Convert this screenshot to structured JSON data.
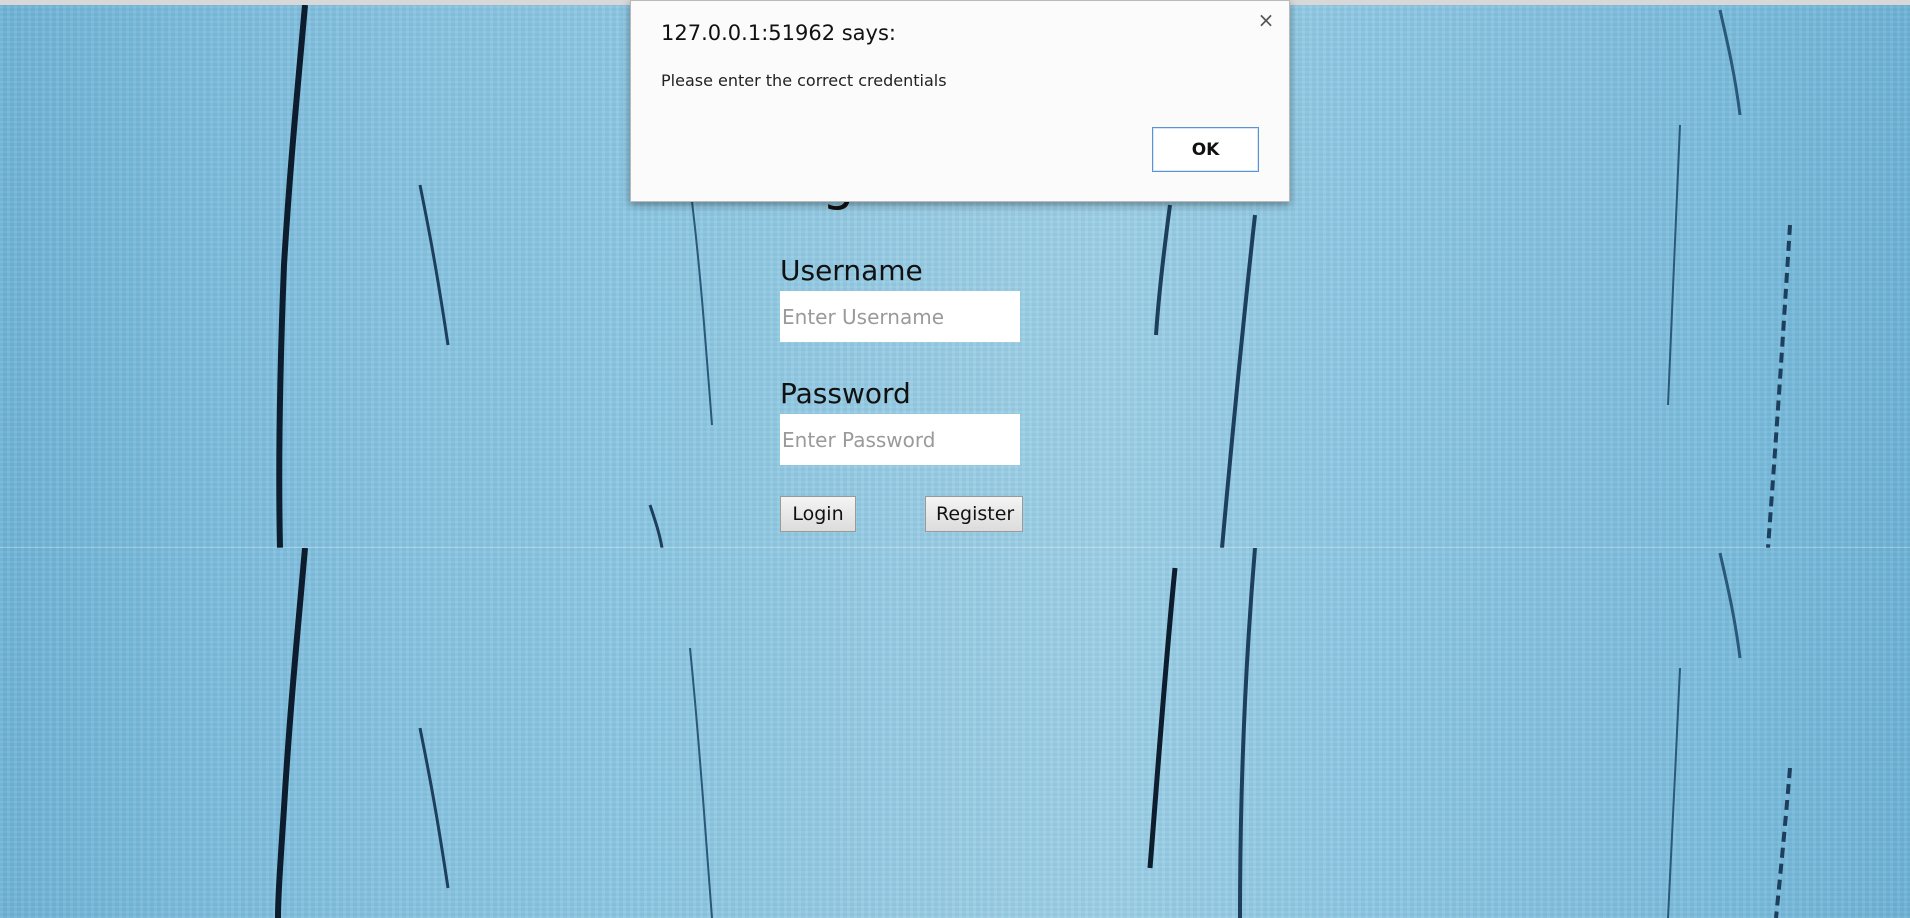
{
  "login": {
    "title": "Login",
    "username_label": "Username",
    "username_placeholder": "Enter Username",
    "password_label": "Password",
    "password_placeholder": "Enter Password",
    "login_button": "Login",
    "register_button": "Register"
  },
  "alert": {
    "title": "127.0.0.1:51962 says:",
    "message": "Please enter the correct credentials",
    "ok_button": "OK",
    "close_symbol": "×"
  },
  "colors": {
    "background": "#8cc7e2",
    "crack": "#0d1d2e",
    "dialog_bg": "#fbfbfb",
    "ok_border": "#5a93d6"
  }
}
